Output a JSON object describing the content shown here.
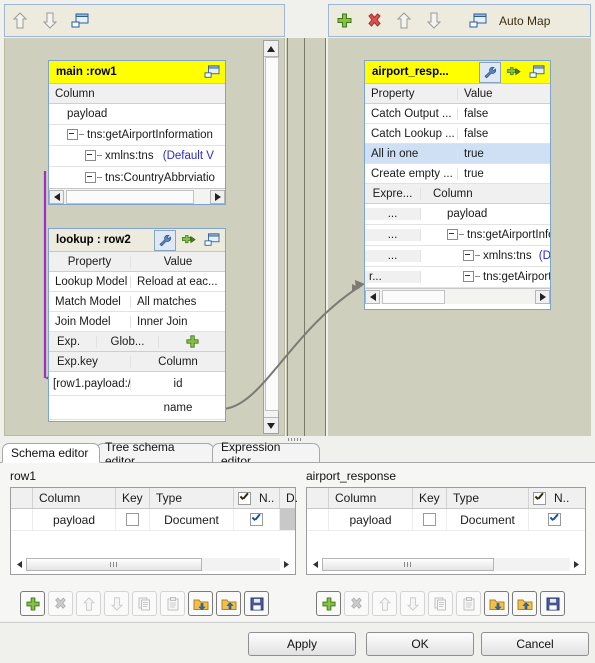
{
  "toolbars": {
    "left": [
      {
        "name": "move-up-icon",
        "label": "Move up"
      },
      {
        "name": "move-down-icon",
        "label": "Move down"
      },
      {
        "name": "minimize-all-icon",
        "label": "Minimize all"
      }
    ],
    "right": [
      {
        "name": "add-icon",
        "label": "Add"
      },
      {
        "name": "remove-icon",
        "label": "Remove"
      },
      {
        "name": "move-up-icon",
        "label": "Move up"
      },
      {
        "name": "move-down-icon",
        "label": "Move down"
      },
      {
        "name": "auto-map-icon",
        "label": "Auto Map"
      }
    ],
    "auto_map_label": "Auto Map"
  },
  "input_panel": {
    "title": "main :row1",
    "header": "Column",
    "rows": [
      {
        "label": "payload",
        "indent": 0,
        "expander": false
      },
      {
        "label": "tns:getAirportInformation",
        "indent": 1,
        "expander": true
      },
      {
        "label": "xmlns:tns",
        "indent": 2,
        "expander": true,
        "extra": "(Default V"
      },
      {
        "label": "tns:CountryAbbrviatio",
        "indent": 2,
        "expander": true
      }
    ]
  },
  "lookup_panel": {
    "title": "lookup : row2",
    "prop_header": "Property",
    "value_header": "Value",
    "properties": [
      {
        "name": "Lookup Model",
        "value": "Reload at eac..."
      },
      {
        "name": "Match Model",
        "value": "All matches"
      },
      {
        "name": "Join Model",
        "value": "Inner Join"
      }
    ],
    "exp_header_left": "Exp.",
    "exp_header_mid": "Glob...",
    "key_header_left": "Exp.key",
    "key_header_right": "Column",
    "key_rows": [
      {
        "expr": "[row1.payload:/",
        "column": "id"
      },
      {
        "expr": "",
        "column": "name"
      }
    ]
  },
  "output_panel": {
    "title": "airport_resp...",
    "prop_header": "Property",
    "value_header": "Value",
    "properties": [
      {
        "name": "Catch Output ...",
        "value": "false",
        "selected": false
      },
      {
        "name": "Catch Lookup ...",
        "value": "false",
        "selected": false
      },
      {
        "name": "All in one",
        "value": "true",
        "selected": true
      },
      {
        "name": "Create empty ...",
        "value": "true",
        "selected": false
      }
    ],
    "expr_header": "Expre...",
    "column_header": "Column",
    "rows": [
      {
        "expr": "...",
        "label": "payload",
        "indent": 0,
        "expander": false
      },
      {
        "expr": "...",
        "label": "tns:getAirportInfo",
        "indent": 1,
        "expander": true
      },
      {
        "expr": "...",
        "label": "xmlns:tns",
        "indent": 2,
        "expander": true,
        "extra": "(D"
      },
      {
        "expr": "r...",
        "label": "tns:getAirport",
        "indent": 2,
        "expander": true
      }
    ]
  },
  "tabs": [
    {
      "label": "Schema editor",
      "active": true
    },
    {
      "label": "Tree schema editor",
      "active": false
    },
    {
      "label": "Expression editor",
      "active": false
    }
  ],
  "schemas": [
    {
      "name": "row1",
      "columns": [
        "Column",
        "Key",
        "Type",
        "",
        "N..",
        "D."
      ],
      "rows": [
        {
          "column": "payload",
          "key": false,
          "type": "Document",
          "check": true
        }
      ]
    },
    {
      "name": "airport_response",
      "columns": [
        "Column",
        "Key",
        "Type",
        "",
        "N.."
      ],
      "rows": [
        {
          "column": "payload",
          "key": false,
          "type": "Document",
          "check": true
        }
      ]
    }
  ],
  "schema_toolbar": [
    {
      "name": "add-column-icon",
      "enabled": true
    },
    {
      "name": "delete-column-icon",
      "enabled": false
    },
    {
      "name": "move-up-icon",
      "enabled": false
    },
    {
      "name": "move-down-icon",
      "enabled": false
    },
    {
      "name": "copy-icon",
      "enabled": false
    },
    {
      "name": "paste-icon",
      "enabled": false
    },
    {
      "name": "import-schema-icon",
      "enabled": true
    },
    {
      "name": "export-schema-icon",
      "enabled": true
    },
    {
      "name": "save-schema-icon",
      "enabled": true
    }
  ],
  "buttons": {
    "apply": "Apply",
    "ok": "OK",
    "cancel": "Cancel"
  },
  "colors": {
    "title_highlight": "#ffff00",
    "selection": "#cfe0f4",
    "link_purple": "#9b30c0",
    "canvas": "#cfcfbd",
    "toolbar": "#edebdd"
  }
}
